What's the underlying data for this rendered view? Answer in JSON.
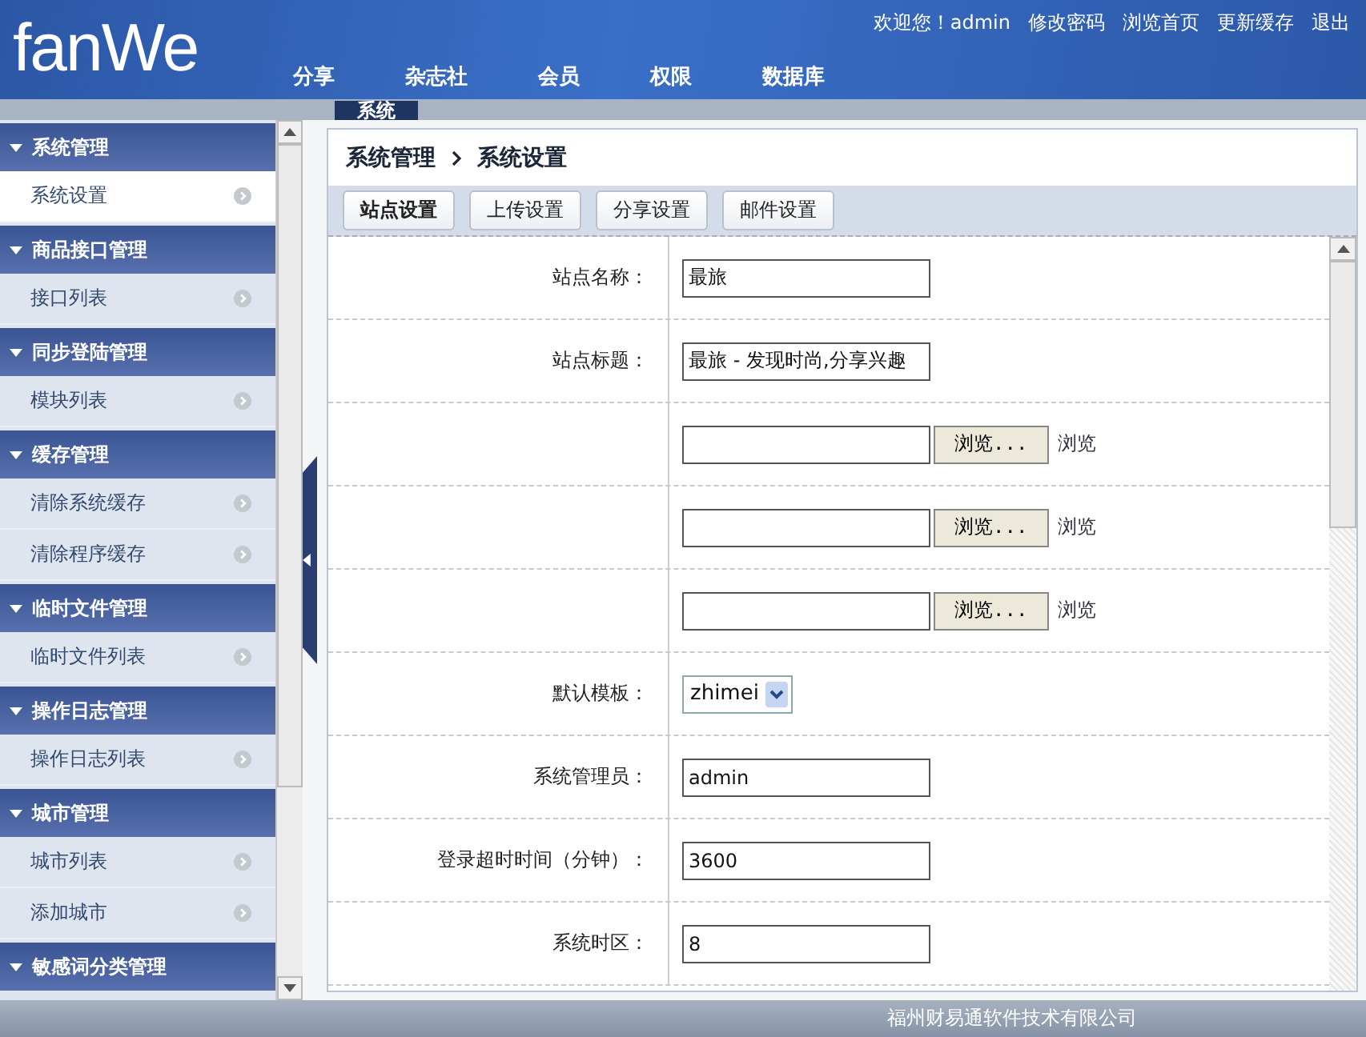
{
  "logo": "fanWe",
  "welcome": "欢迎您！admin",
  "user_links": [
    "修改密码",
    "浏览首页",
    "更新缓存",
    "退出"
  ],
  "nav_tabs": [
    {
      "label": "分享",
      "selected": false
    },
    {
      "label": "杂志社",
      "selected": false
    },
    {
      "label": "会员",
      "selected": false
    },
    {
      "label": "权限",
      "selected": false
    },
    {
      "label": "数据库",
      "selected": false
    }
  ],
  "active_tab": {
    "label": "系统",
    "selected": true
  },
  "sidebar": [
    {
      "title": "系统管理",
      "expanded": true,
      "items": [
        {
          "label": "系统设置",
          "selected": true
        }
      ]
    },
    {
      "title": "商品接口管理",
      "expanded": true,
      "items": [
        {
          "label": "接口列表",
          "selected": false
        }
      ]
    },
    {
      "title": "同步登陆管理",
      "expanded": true,
      "items": [
        {
          "label": "模块列表",
          "selected": false
        }
      ]
    },
    {
      "title": "缓存管理",
      "expanded": true,
      "items": [
        {
          "label": "清除系统缓存",
          "selected": false
        },
        {
          "label": "清除程序缓存",
          "selected": false
        }
      ]
    },
    {
      "title": "临时文件管理",
      "expanded": true,
      "items": [
        {
          "label": "临时文件列表",
          "selected": false
        }
      ]
    },
    {
      "title": "操作日志管理",
      "expanded": true,
      "items": [
        {
          "label": "操作日志列表",
          "selected": false
        }
      ]
    },
    {
      "title": "城市管理",
      "expanded": true,
      "items": [
        {
          "label": "城市列表",
          "selected": false
        },
        {
          "label": "添加城市",
          "selected": false
        }
      ]
    },
    {
      "title": "敏感词分类管理",
      "expanded": true
    }
  ],
  "breadcrumb": {
    "parent": "系统管理",
    "current": "系统设置"
  },
  "setting_tabs": [
    {
      "label": "站点设置",
      "selected": true
    },
    {
      "label": "上传设置",
      "selected": false
    },
    {
      "label": "分享设置",
      "selected": false
    },
    {
      "label": "邮件设置",
      "selected": false
    }
  ],
  "form_rows": [
    {
      "kind": "text",
      "label": "站点名称：",
      "value": "最旅"
    },
    {
      "kind": "text",
      "label": "站点标题：",
      "value": "最旅 - 发现时尚,分享兴趣"
    },
    {
      "kind": "file",
      "button": "浏览...",
      "link": "浏览"
    },
    {
      "kind": "file",
      "button": "浏览...",
      "link": "浏览"
    },
    {
      "kind": "file",
      "button": "浏览...",
      "link": "浏览"
    },
    {
      "kind": "select",
      "label": "默认模板：",
      "value": "zhimei"
    },
    {
      "kind": "text",
      "label": "系统管理员：",
      "value": "admin"
    },
    {
      "kind": "text",
      "label": "登录超时时间（分钟）：",
      "value": "3600"
    },
    {
      "kind": "text",
      "label": "系统时区：",
      "value": "8"
    }
  ],
  "footer": "福州财易通软件技术有限公司"
}
